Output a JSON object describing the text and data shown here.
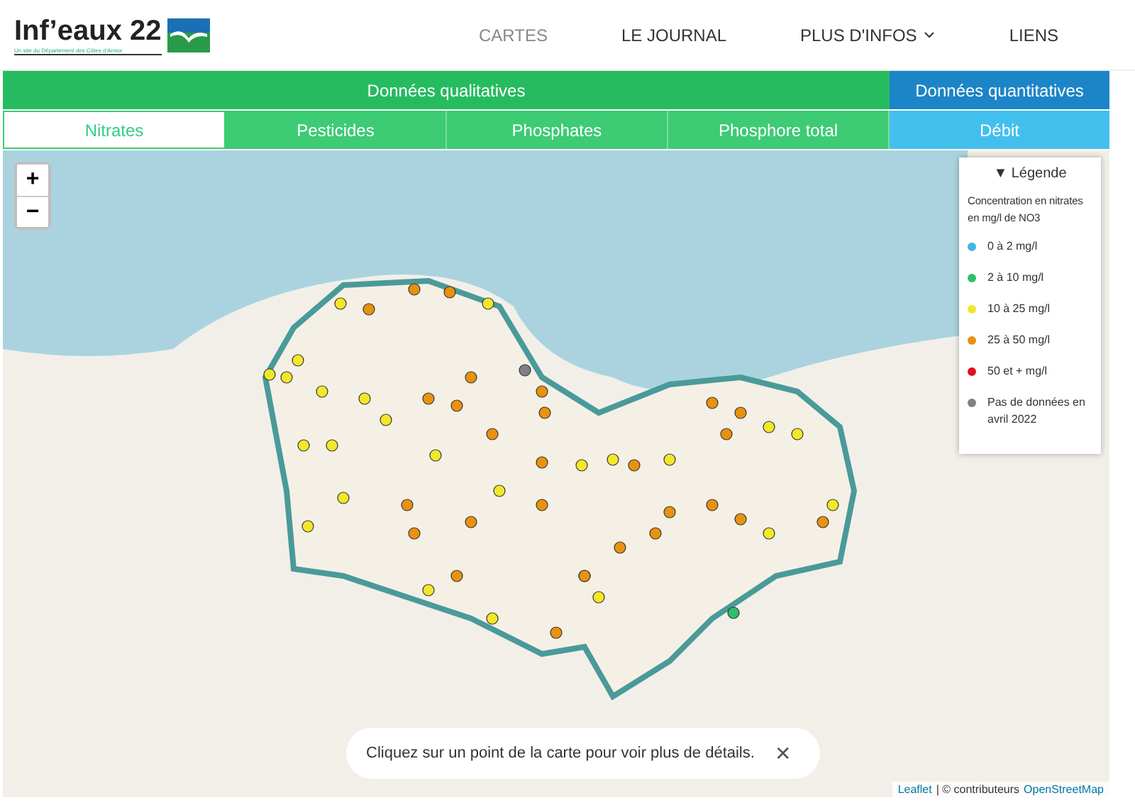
{
  "logo": {
    "title": "Inf’eaux 22",
    "subtitle": "Un site du Département des Côtes d'Armor"
  },
  "nav": [
    {
      "label": "CARTES",
      "selected": true,
      "dropdown": false
    },
    {
      "label": "LE JOURNAL",
      "selected": false,
      "dropdown": false
    },
    {
      "label": "PLUS D'INFOS",
      "selected": false,
      "dropdown": true
    },
    {
      "label": "LIENS",
      "selected": false,
      "dropdown": false
    }
  ],
  "groups": [
    {
      "label": "Données qualitatives",
      "kind": "quality",
      "tabs": [
        {
          "label": "Nitrates",
          "selected": true
        },
        {
          "label": "Pesticides",
          "selected": false
        },
        {
          "label": "Phosphates",
          "selected": false
        },
        {
          "label": "Phosphore total",
          "selected": false
        }
      ]
    },
    {
      "label": "Données quantitatives",
      "kind": "quantity",
      "tabs": [
        {
          "label": "Débit",
          "selected": false
        }
      ]
    }
  ],
  "zoom": {
    "in": "+",
    "out": "−"
  },
  "legend": {
    "title": "▼ Légende",
    "subtitle": "Concentration en nitrates en mg/l de NO3",
    "items": [
      {
        "label": "0 à 2 mg/l",
        "color": "#3fb6e8"
      },
      {
        "label": "2 à 10 mg/l",
        "color": "#2fbf6b"
      },
      {
        "label": "10 à 25 mg/l",
        "color": "#f2e72a"
      },
      {
        "label": "25 à 50 mg/l",
        "color": "#e8920f"
      },
      {
        "label": "50 et + mg/l",
        "color": "#e0101e"
      },
      {
        "label": "Pas de données en avril 2022",
        "color": "#808080"
      }
    ]
  },
  "toast": {
    "message": "Cliquez sur un point de la carte pour voir plus de détails.",
    "close": "✕"
  },
  "attribution": {
    "link": "Leaflet",
    "text": "| © contributeurs",
    "osm": "OpenStreetMap"
  }
}
